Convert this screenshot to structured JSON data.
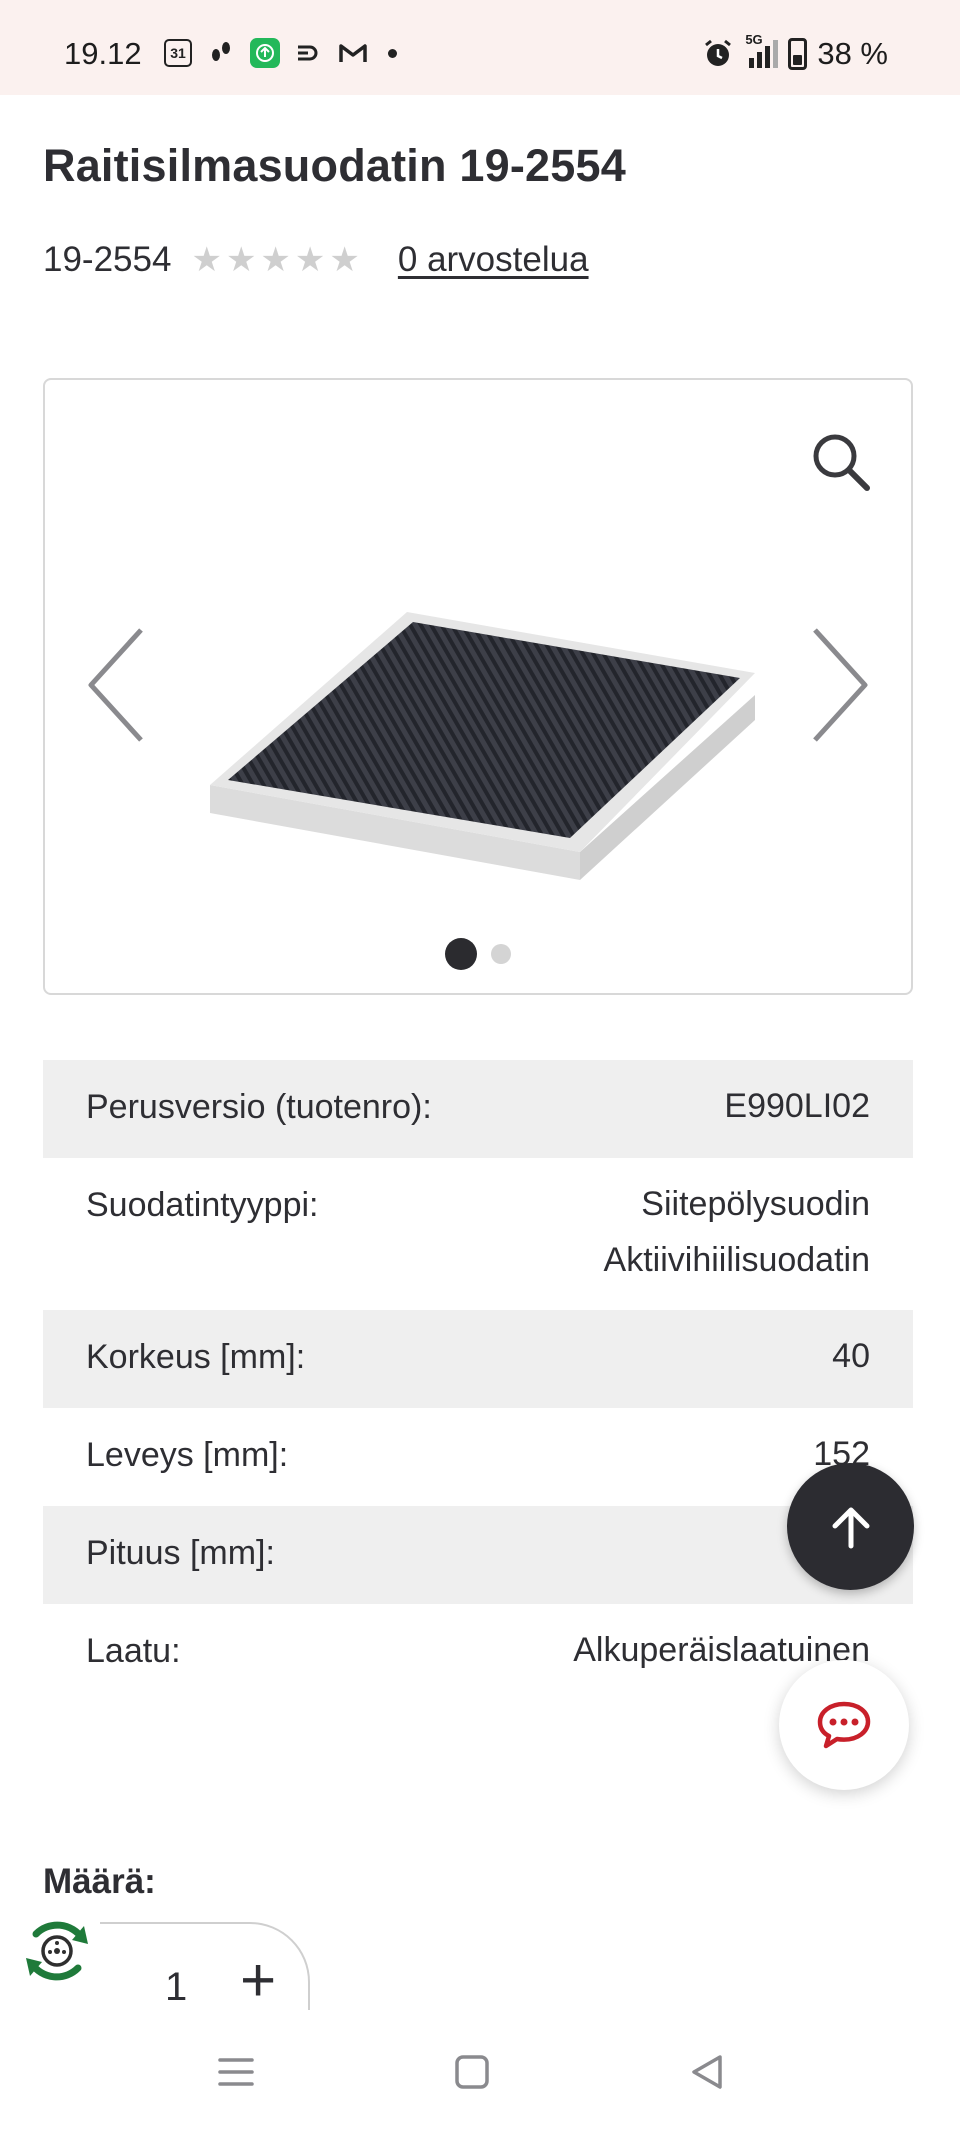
{
  "status_bar": {
    "time": "19.12",
    "calendar_day": "31",
    "battery": "38 %",
    "network": "5G"
  },
  "product": {
    "title": "Raitisilmasuodatin 19-2554",
    "sku": "19-2554",
    "rating_stars": 0,
    "rating_max": 5,
    "reviews_link": "0 arvostelua"
  },
  "gallery": {
    "active_slide": 1,
    "slide_count": 2
  },
  "specs": [
    {
      "label": "Perusversio (tuotenro):",
      "value": "E990LI02"
    },
    {
      "label": "Suodatintyyppi:",
      "value": "Siitepölysuodin",
      "value2": "Aktiivihiilisuodatin"
    },
    {
      "label": "Korkeus [mm]:",
      "value": "40"
    },
    {
      "label": "Leveys [mm]:",
      "value": "152"
    },
    {
      "label": "Pituus [mm]:",
      "value": ""
    },
    {
      "label": "Laatu:",
      "value": "Alkuperäislaatuinen"
    }
  ],
  "quantity": {
    "label": "Määrä:",
    "value": "1",
    "plus": "+"
  },
  "colors": {
    "status_bar_bg": "#fbf1ef",
    "fab_dark": "#2c2c31",
    "chat_accent": "#c8202a",
    "row_shade": "#efefef",
    "recycle_green": "#1f7a3a"
  },
  "icons": [
    "search-icon",
    "chevron-left-icon",
    "chevron-right-icon",
    "arrow-up-icon",
    "chat-icon",
    "recycle-icon",
    "menu-icon",
    "home-icon",
    "back-icon"
  ]
}
